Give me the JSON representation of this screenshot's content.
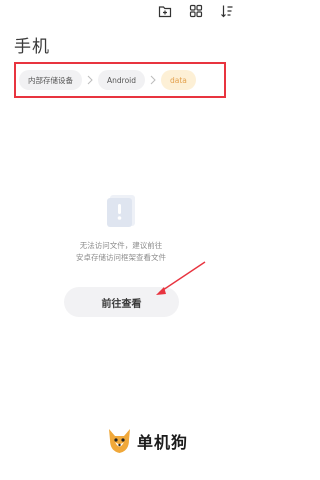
{
  "header": {
    "title": "手机",
    "icons": [
      "add-folder-icon",
      "grid-view-icon",
      "sort-icon"
    ]
  },
  "breadcrumb": {
    "items": [
      "内部存储设备",
      "Android",
      "data"
    ],
    "highlight_color": "#e8343f"
  },
  "empty_state": {
    "icon": "lock-shield-icon",
    "message_line1": "无法访问文件，建议前往",
    "message_line2": "安卓存储访问框架查看文件",
    "button_label": "前往查看"
  },
  "watermark": {
    "text": "单机狗",
    "icon": "dog-logo-icon"
  },
  "colors": {
    "accent_red": "#e8343f",
    "active_crumb": "#e3a14d",
    "active_crumb_bg": "#fdf0d6"
  }
}
